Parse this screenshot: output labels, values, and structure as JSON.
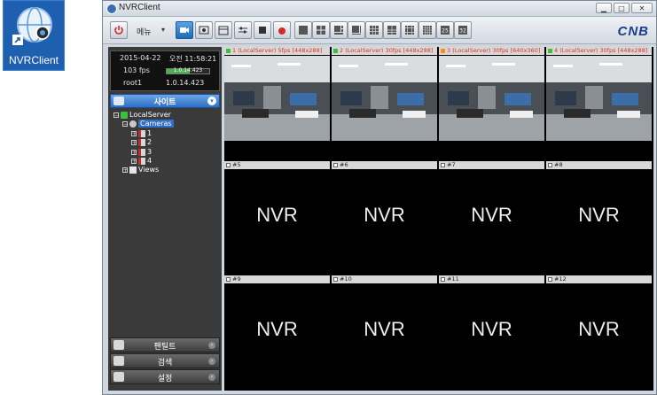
{
  "desktop": {
    "icon_label": "NVRClient"
  },
  "window": {
    "title": "NVRClient",
    "brand": "CNB"
  },
  "toolbar": {
    "menu_label": "메뉴",
    "menu_arrow": "▾"
  },
  "status": {
    "date": "2015-04-22",
    "time": "오전 11:58:21",
    "fps": "103 fps",
    "fps_fill": 0.55,
    "version": "1.0.14.423",
    "user": "root1"
  },
  "sidebar": {
    "site_label": "사이트",
    "tree": {
      "root": "LocalServer",
      "cameras": "Cameras",
      "camera_items": [
        "1",
        "2",
        "3",
        "4"
      ],
      "views": "Views"
    },
    "panels": [
      {
        "label": "팬틸트"
      },
      {
        "label": "검색"
      },
      {
        "label": "설정"
      }
    ]
  },
  "colors": {
    "selected": "#2f6fca",
    "header_blue": "#2d6fc4",
    "text_red": "#e03020"
  },
  "grid": {
    "cells": [
      {
        "header": "1 (LocalServer) 5fps [448x288]",
        "status": "green",
        "live": true
      },
      {
        "header": "2 (LocalServer) 30fps [448x288]",
        "status": "green",
        "live": true
      },
      {
        "header": "3 (LocalServer) 30fps [640x360]",
        "status": "orange",
        "live": true
      },
      {
        "header": "4 (LocalServer) 30fps [448x288]",
        "status": "green",
        "live": true
      },
      {
        "header": "#5",
        "live": false
      },
      {
        "header": "#6",
        "live": false
      },
      {
        "header": "#7",
        "live": false
      },
      {
        "header": "#8",
        "live": false
      },
      {
        "header": "#9",
        "live": false
      },
      {
        "header": "#10",
        "live": false
      },
      {
        "header": "#11",
        "live": false
      },
      {
        "header": "#12",
        "live": false
      }
    ],
    "placeholder": "NVR"
  }
}
